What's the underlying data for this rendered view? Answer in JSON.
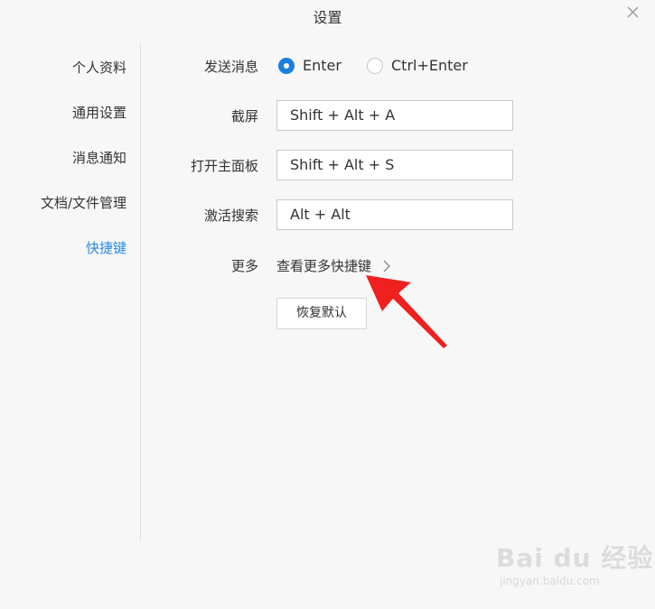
{
  "window": {
    "title": "设置"
  },
  "sidebar": {
    "items": [
      {
        "label": "个人资料"
      },
      {
        "label": "通用设置"
      },
      {
        "label": "消息通知"
      },
      {
        "label": "文档/文件管理"
      },
      {
        "label": "快捷键",
        "active": true
      }
    ]
  },
  "shortcuts": {
    "send_message": {
      "label": "发送消息",
      "options": [
        {
          "label": "Enter",
          "checked": true
        },
        {
          "label": "Ctrl+Enter",
          "checked": false
        }
      ]
    },
    "screenshot": {
      "label": "截屏",
      "value": "Shift + Alt + A"
    },
    "open_main_panel": {
      "label": "打开主面板",
      "value": "Shift + Alt + S"
    },
    "activate_search": {
      "label": "激活搜索",
      "value": "Alt + Alt"
    },
    "more": {
      "label": "更多",
      "link": "查看更多快捷键"
    },
    "reset_label": "恢复默认"
  },
  "colors": {
    "accent": "#1a7fe0",
    "active_nav": "#2a8ae0",
    "annotation_arrow": "#f02020"
  },
  "watermark": {
    "logo": "Bai du 经验",
    "url": "jingyan.baidu.com"
  }
}
